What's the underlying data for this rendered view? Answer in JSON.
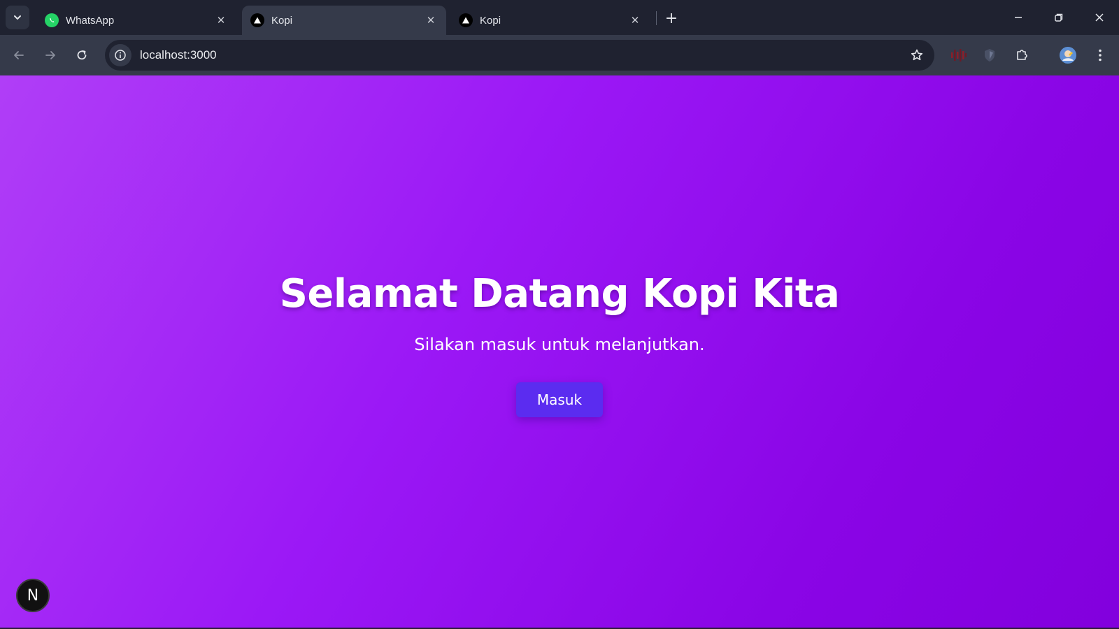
{
  "browser": {
    "tabs": [
      {
        "title": "WhatsApp",
        "favicon": "whatsapp-icon",
        "active": false
      },
      {
        "title": "Kopi",
        "favicon": "nextjs-triangle-icon",
        "active": true
      },
      {
        "title": "Kopi",
        "favicon": "nextjs-triangle-icon",
        "active": false
      }
    ],
    "close_glyph": "✕",
    "new_tab_glyph": "+",
    "url": "localhost:3000"
  },
  "page": {
    "heading": "Selamat Datang Kopi Kita",
    "subheading": "Silakan masuk untuk melanjutkan.",
    "button_label": "Masuk",
    "badge_letter": "N"
  },
  "colors": {
    "gradient_start": "#b03ef7",
    "gradient_end": "#8200dd",
    "button": "#5b2cf0",
    "browser_chrome": "#1f2230",
    "toolbar": "#353a4a"
  }
}
